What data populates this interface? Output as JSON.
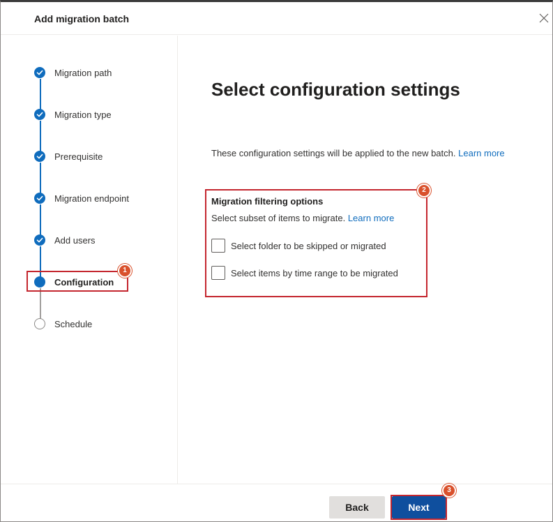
{
  "dialog": {
    "title": "Add migration batch",
    "close_icon": "close-icon"
  },
  "steps": [
    {
      "label": "Migration path",
      "state": "done"
    },
    {
      "label": "Migration type",
      "state": "done"
    },
    {
      "label": "Prerequisite",
      "state": "done"
    },
    {
      "label": "Migration endpoint",
      "state": "done"
    },
    {
      "label": "Add users",
      "state": "done"
    },
    {
      "label": "Configuration",
      "state": "current"
    },
    {
      "label": "Schedule",
      "state": "todo"
    }
  ],
  "main": {
    "heading": "Select configuration settings",
    "description": "These configuration settings will be applied to the new batch.",
    "description_link": "Learn more",
    "filtering": {
      "title": "Migration filtering options",
      "subtitle": "Select subset of items to migrate.",
      "subtitle_link": "Learn more",
      "options": [
        {
          "label": "Select folder to be skipped or migrated",
          "checked": false
        },
        {
          "label": "Select items by time range to be migrated",
          "checked": false
        }
      ]
    }
  },
  "footer": {
    "back_label": "Back",
    "next_label": "Next"
  },
  "annotations": {
    "badge_1": "1",
    "badge_2": "2",
    "badge_3": "3"
  },
  "colors": {
    "accent": "#0f6cbd",
    "primary_button": "#0f4f9e",
    "highlight": "#c4262e",
    "badge": "#d9512c"
  }
}
